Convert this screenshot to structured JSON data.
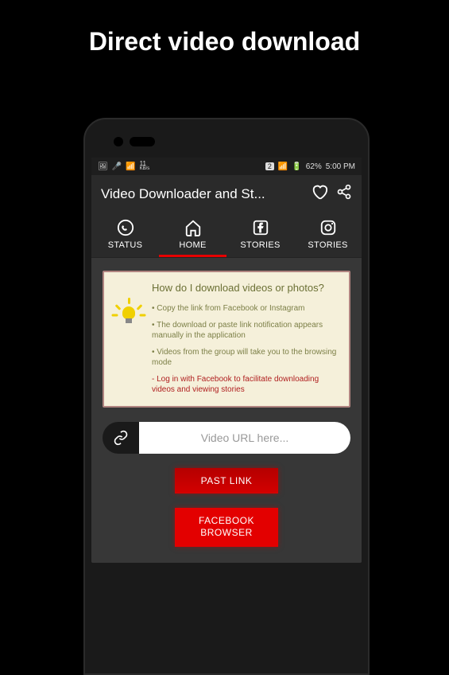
{
  "page_title": "Direct video download",
  "statusbar": {
    "left_kb": "11",
    "left_kbs": "KB/s",
    "sim": "2",
    "battery": "62%",
    "time": "5:00 PM"
  },
  "appbar": {
    "title": "Video Downloader and St..."
  },
  "tabs": [
    {
      "label": "STATUS"
    },
    {
      "label": "HOME"
    },
    {
      "label": "STORIES"
    },
    {
      "label": "STORIES"
    }
  ],
  "info": {
    "heading": "How do I download videos or photos?",
    "b1": "• Copy the link from Facebook or Instagram",
    "b2": "• The download or paste link notification appears manually in the application",
    "b3": "• Videos from the group will take you to the browsing mode",
    "warn": "- Log in with Facebook to facilitate downloading videos and viewing stories"
  },
  "url": {
    "placeholder": "Video URL here..."
  },
  "buttons": {
    "paste": "PAST LINK",
    "browser": "FACEBOOK BROWSER"
  }
}
